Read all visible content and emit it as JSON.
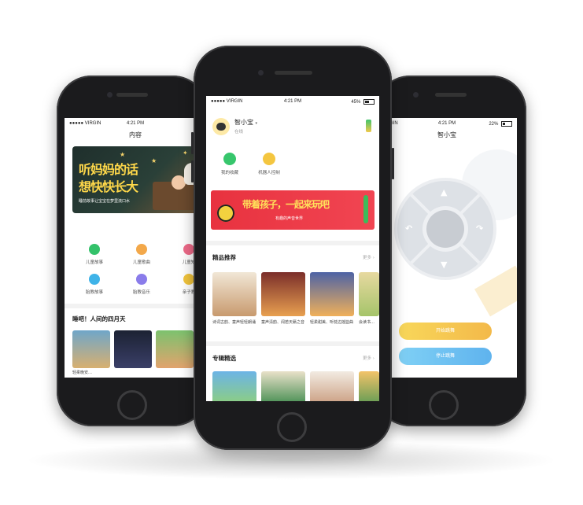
{
  "phones": {
    "left": {
      "status": {
        "carrier": "●●●●● VIRGIN",
        "time": "4:21 PM"
      },
      "title": "内容",
      "banner": {
        "line1": "听妈妈的话",
        "line2": "想快快长大",
        "sub": "睡前故事让宝宝在梦里流口水"
      },
      "categories": [
        "儿童故事",
        "儿童歌曲",
        "儿童知",
        "胎教故事",
        "胎教音乐",
        "亲子教"
      ],
      "section_title": "睡吧！人间的四月天",
      "thumb_captions": [
        "轻柔晚安…",
        "…",
        "奇…",
        "…",
        "…"
      ]
    },
    "center": {
      "status": {
        "carrier": "●●●●● VIRGIN",
        "time": "4:21 PM",
        "battery": "45%"
      },
      "profile": {
        "name": "智小宝",
        "state": "在线"
      },
      "quick": [
        {
          "label": "我的收藏",
          "icon": "star-icon"
        },
        {
          "label": "机器人控制",
          "icon": "robot-icon"
        }
      ],
      "banner": {
        "headline": "带着孩子，一起来玩吧",
        "sub": "有趣的声音世界"
      },
      "featured": {
        "title": "精品推荐",
        "more": "更多 ›",
        "items": [
          "诗词古韵、童声轻轻朗诵",
          "童声清韵、闻若天籁之音",
          "轻柔甜美、听枕边摇篮曲",
          "会读书…"
        ]
      },
      "albums": {
        "title": "专辑精选",
        "more": "更多 ›"
      }
    },
    "right": {
      "status": {
        "carrier": "VIRGIN",
        "time": "4:21 PM",
        "battery": "22%"
      },
      "title": "智小宝",
      "controls": {
        "start": "开始跳舞",
        "stop": "停止跳舞"
      },
      "accent": "#f5c94b",
      "stop_color": "#6cc0f2"
    }
  }
}
